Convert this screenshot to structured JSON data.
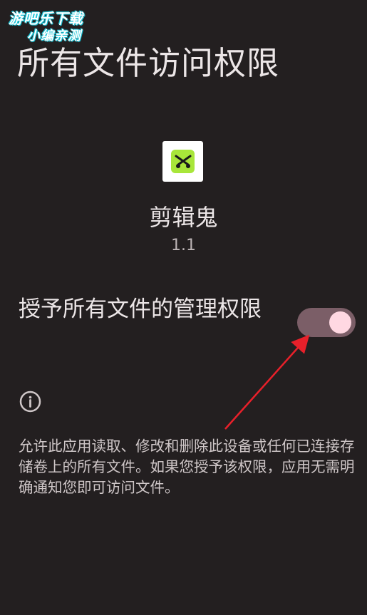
{
  "watermark": {
    "line1": "游吧乐下载",
    "line2": "小编亲测"
  },
  "page": {
    "title": "所有文件访问权限"
  },
  "app": {
    "icon": "scissors-icon",
    "name": "剪辑鬼",
    "version": "1.1"
  },
  "permission": {
    "label": "授予所有文件的管理权限",
    "toggle_state": "on"
  },
  "info": {
    "icon": "info-icon",
    "description": "允许此应用读取、修改和删除此设备或任何已连接存储卷上的所有文件。如果您授予该权限，应用无需明确通知您即可访问文件。"
  },
  "colors": {
    "background": "#231f20",
    "toggle_track": "#7b5e67",
    "toggle_thumb": "#ffd8e2",
    "annotation_arrow": "#e8202a",
    "app_icon_accent": "#a8e63a"
  }
}
